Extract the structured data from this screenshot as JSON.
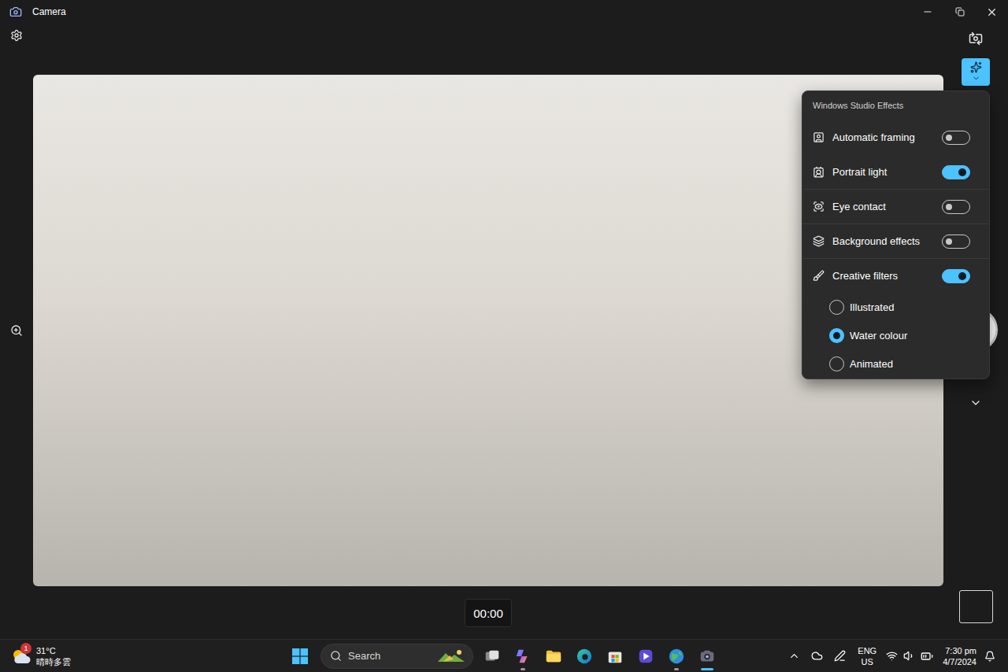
{
  "window": {
    "title": "Camera"
  },
  "timer": "00:00",
  "effects_button": {
    "active": true
  },
  "effects_panel": {
    "title": "Windows Studio Effects",
    "toggles": [
      {
        "label": "Automatic framing",
        "on": false
      },
      {
        "label": "Portrait light",
        "on": true
      },
      {
        "label": "Eye contact",
        "on": false
      },
      {
        "label": "Background effects",
        "on": false
      },
      {
        "label": "Creative filters",
        "on": true
      }
    ],
    "filters": [
      {
        "label": "Illustrated",
        "selected": false
      },
      {
        "label": "Water colour",
        "selected": true
      },
      {
        "label": "Animated",
        "selected": false
      }
    ]
  },
  "taskbar": {
    "weather": {
      "temperature": "31°C",
      "condition": "晴時多雲",
      "badge": "1"
    },
    "search": {
      "placeholder": "Search"
    },
    "apps": [
      {
        "kind": "taskview",
        "running": false,
        "active": false
      },
      {
        "kind": "copilot",
        "running": true,
        "active": false
      },
      {
        "kind": "explorer",
        "running": false,
        "active": false
      },
      {
        "kind": "edge",
        "running": false,
        "active": false
      },
      {
        "kind": "store",
        "running": false,
        "active": false
      },
      {
        "kind": "clipchamp",
        "running": false,
        "active": false
      },
      {
        "kind": "maps",
        "running": true,
        "active": false
      },
      {
        "kind": "camera",
        "running": true,
        "active": true
      }
    ],
    "language": {
      "primary": "ENG",
      "secondary": "US"
    },
    "clock": {
      "time": "7:30 pm",
      "date": "4/7/2024"
    }
  }
}
